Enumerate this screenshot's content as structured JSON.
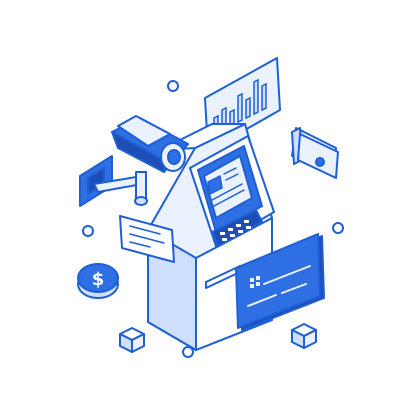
{
  "illustration": {
    "subject": "",
    "palette": {
      "stroke": "#1E5FD6",
      "primary": "#2F6FE4",
      "light": "#EAF1FF",
      "mid": "#CFE0FF",
      "dark": "#1C4EB5",
      "white": "#FFFFFF"
    },
    "icons": [
      "atm-icon",
      "security-camera-icon",
      "bar-chart-icon",
      "wallet-icon",
      "credit-card-icon",
      "dollar-coin-icon",
      "message-icon",
      "cube-icon"
    ],
    "currency_symbol": "$"
  }
}
